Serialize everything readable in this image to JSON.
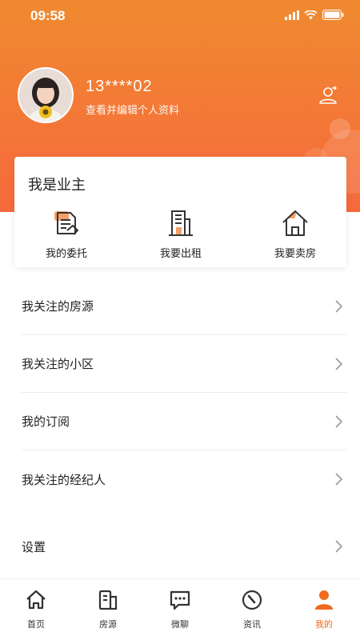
{
  "status_bar": {
    "time": "09:58"
  },
  "profile": {
    "username": "13****02",
    "subtitle": "查看并编辑个人资料",
    "avatar_icon": "user-avatar-photo",
    "switch_icon": "user-switch-icon"
  },
  "owner_section": {
    "title": "我是业主",
    "items": [
      {
        "label": "我的委托",
        "icon": "document-entrust-icon"
      },
      {
        "label": "我要出租",
        "icon": "building-rent-icon"
      },
      {
        "label": "我要卖房",
        "icon": "house-sell-icon"
      }
    ]
  },
  "menu": {
    "items": [
      {
        "label": "我关注的房源"
      },
      {
        "label": "我关注的小区"
      },
      {
        "label": "我的订阅"
      },
      {
        "label": "我关注的经纪人"
      }
    ],
    "settings": "设置"
  },
  "tabbar": {
    "tabs": [
      {
        "label": "首页",
        "icon": "home-icon"
      },
      {
        "label": "房源",
        "icon": "listing-icon"
      },
      {
        "label": "微聊",
        "icon": "chat-icon"
      },
      {
        "label": "资讯",
        "icon": "news-icon"
      },
      {
        "label": "我的",
        "icon": "profile-icon"
      }
    ]
  },
  "colors": {
    "accent": "#f06a1e",
    "header_top": "#f08a30",
    "header_bottom": "#f6693c"
  }
}
